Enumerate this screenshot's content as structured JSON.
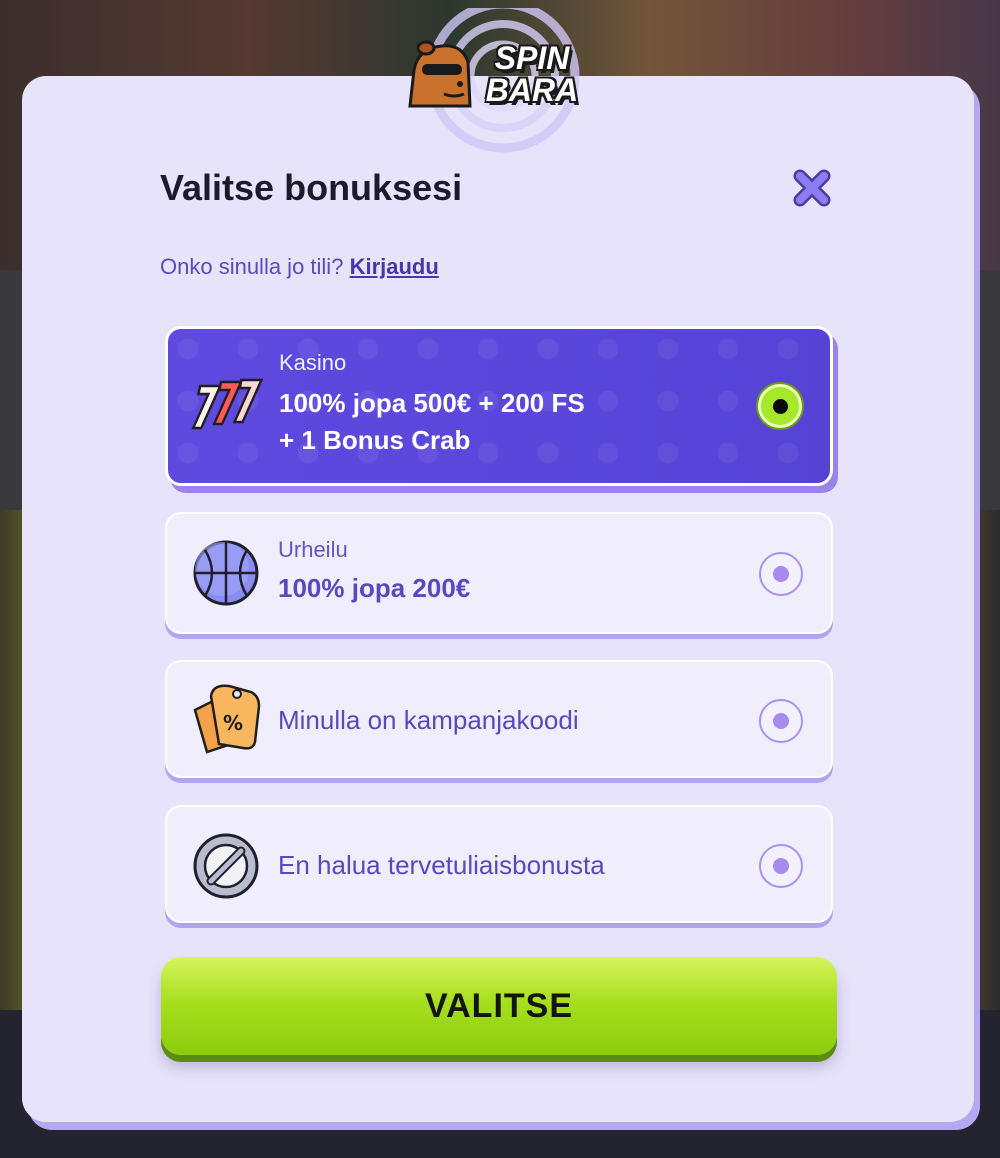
{
  "brand": {
    "logo_text_line1": "SPIN",
    "logo_text_line2": "BARA",
    "accent_color": "#5d48dc",
    "cta_color": "#a7df1e"
  },
  "modal": {
    "title": "Valitse bonuksesi",
    "close_icon": "close-icon",
    "account_question": "Onko sinulla jo tili?",
    "login_link": "Kirjaudu"
  },
  "options": [
    {
      "icon": "slot-777-icon",
      "label": "Kasino",
      "value_line1": "100% jopa 500€ + 200 FS",
      "value_line2": "+ 1 Bonus Crab",
      "selected": true
    },
    {
      "icon": "basketball-icon",
      "label": "Urheilu",
      "value_line1": "100% jopa 200€",
      "selected": false
    },
    {
      "icon": "promo-tag-icon",
      "label": "Minulla on kampanjakoodi",
      "selected": false
    },
    {
      "icon": "no-bonus-icon",
      "label": "En halua tervetuliaisbonusta",
      "selected": false
    }
  ],
  "cta": {
    "label": "VALITSE"
  }
}
